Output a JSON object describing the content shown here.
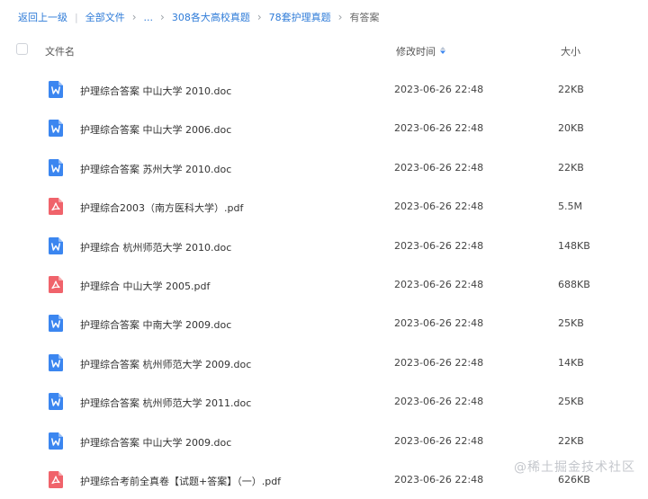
{
  "breadcrumb": {
    "back": "返回上一级",
    "all_files": "全部文件",
    "ellipsis": "...",
    "folder1": "308各大高校真题",
    "folder2": "78套护理真题",
    "current": "有答案"
  },
  "header": {
    "name": "文件名",
    "modified": "修改时间",
    "size": "大小"
  },
  "colors": {
    "link": "#2e7bd8",
    "doc_icon": "#3b86f0",
    "pdf_icon": "#f0636b"
  },
  "files": [
    {
      "name": "护理综合答案 中山大学 2010.doc",
      "time": "2023-06-26 22:48",
      "size": "22KB",
      "type": "doc"
    },
    {
      "name": "护理综合答案 中山大学 2006.doc",
      "time": "2023-06-26 22:48",
      "size": "20KB",
      "type": "doc"
    },
    {
      "name": "护理综合答案 苏州大学 2010.doc",
      "time": "2023-06-26 22:48",
      "size": "22KB",
      "type": "doc"
    },
    {
      "name": "护理综合2003（南方医科大学）.pdf",
      "time": "2023-06-26 22:48",
      "size": "5.5M",
      "type": "pdf"
    },
    {
      "name": "护理综合 杭州师范大学 2010.doc",
      "time": "2023-06-26 22:48",
      "size": "148KB",
      "type": "doc"
    },
    {
      "name": "护理综合 中山大学 2005.pdf",
      "time": "2023-06-26 22:48",
      "size": "688KB",
      "type": "pdf"
    },
    {
      "name": "护理综合答案 中南大学 2009.doc",
      "time": "2023-06-26 22:48",
      "size": "25KB",
      "type": "doc"
    },
    {
      "name": "护理综合答案 杭州师范大学 2009.doc",
      "time": "2023-06-26 22:48",
      "size": "14KB",
      "type": "doc"
    },
    {
      "name": "护理综合答案 杭州师范大学 2011.doc",
      "time": "2023-06-26 22:48",
      "size": "25KB",
      "type": "doc"
    },
    {
      "name": "护理综合答案 中山大学 2009.doc",
      "time": "2023-06-26 22:48",
      "size": "22KB",
      "type": "doc"
    },
    {
      "name": "护理综合考前全真卷【试题+答案】（一）.pdf",
      "time": "2023-06-26 22:48",
      "size": "626KB",
      "type": "pdf"
    }
  ],
  "watermark": "@稀土掘金技术社区"
}
